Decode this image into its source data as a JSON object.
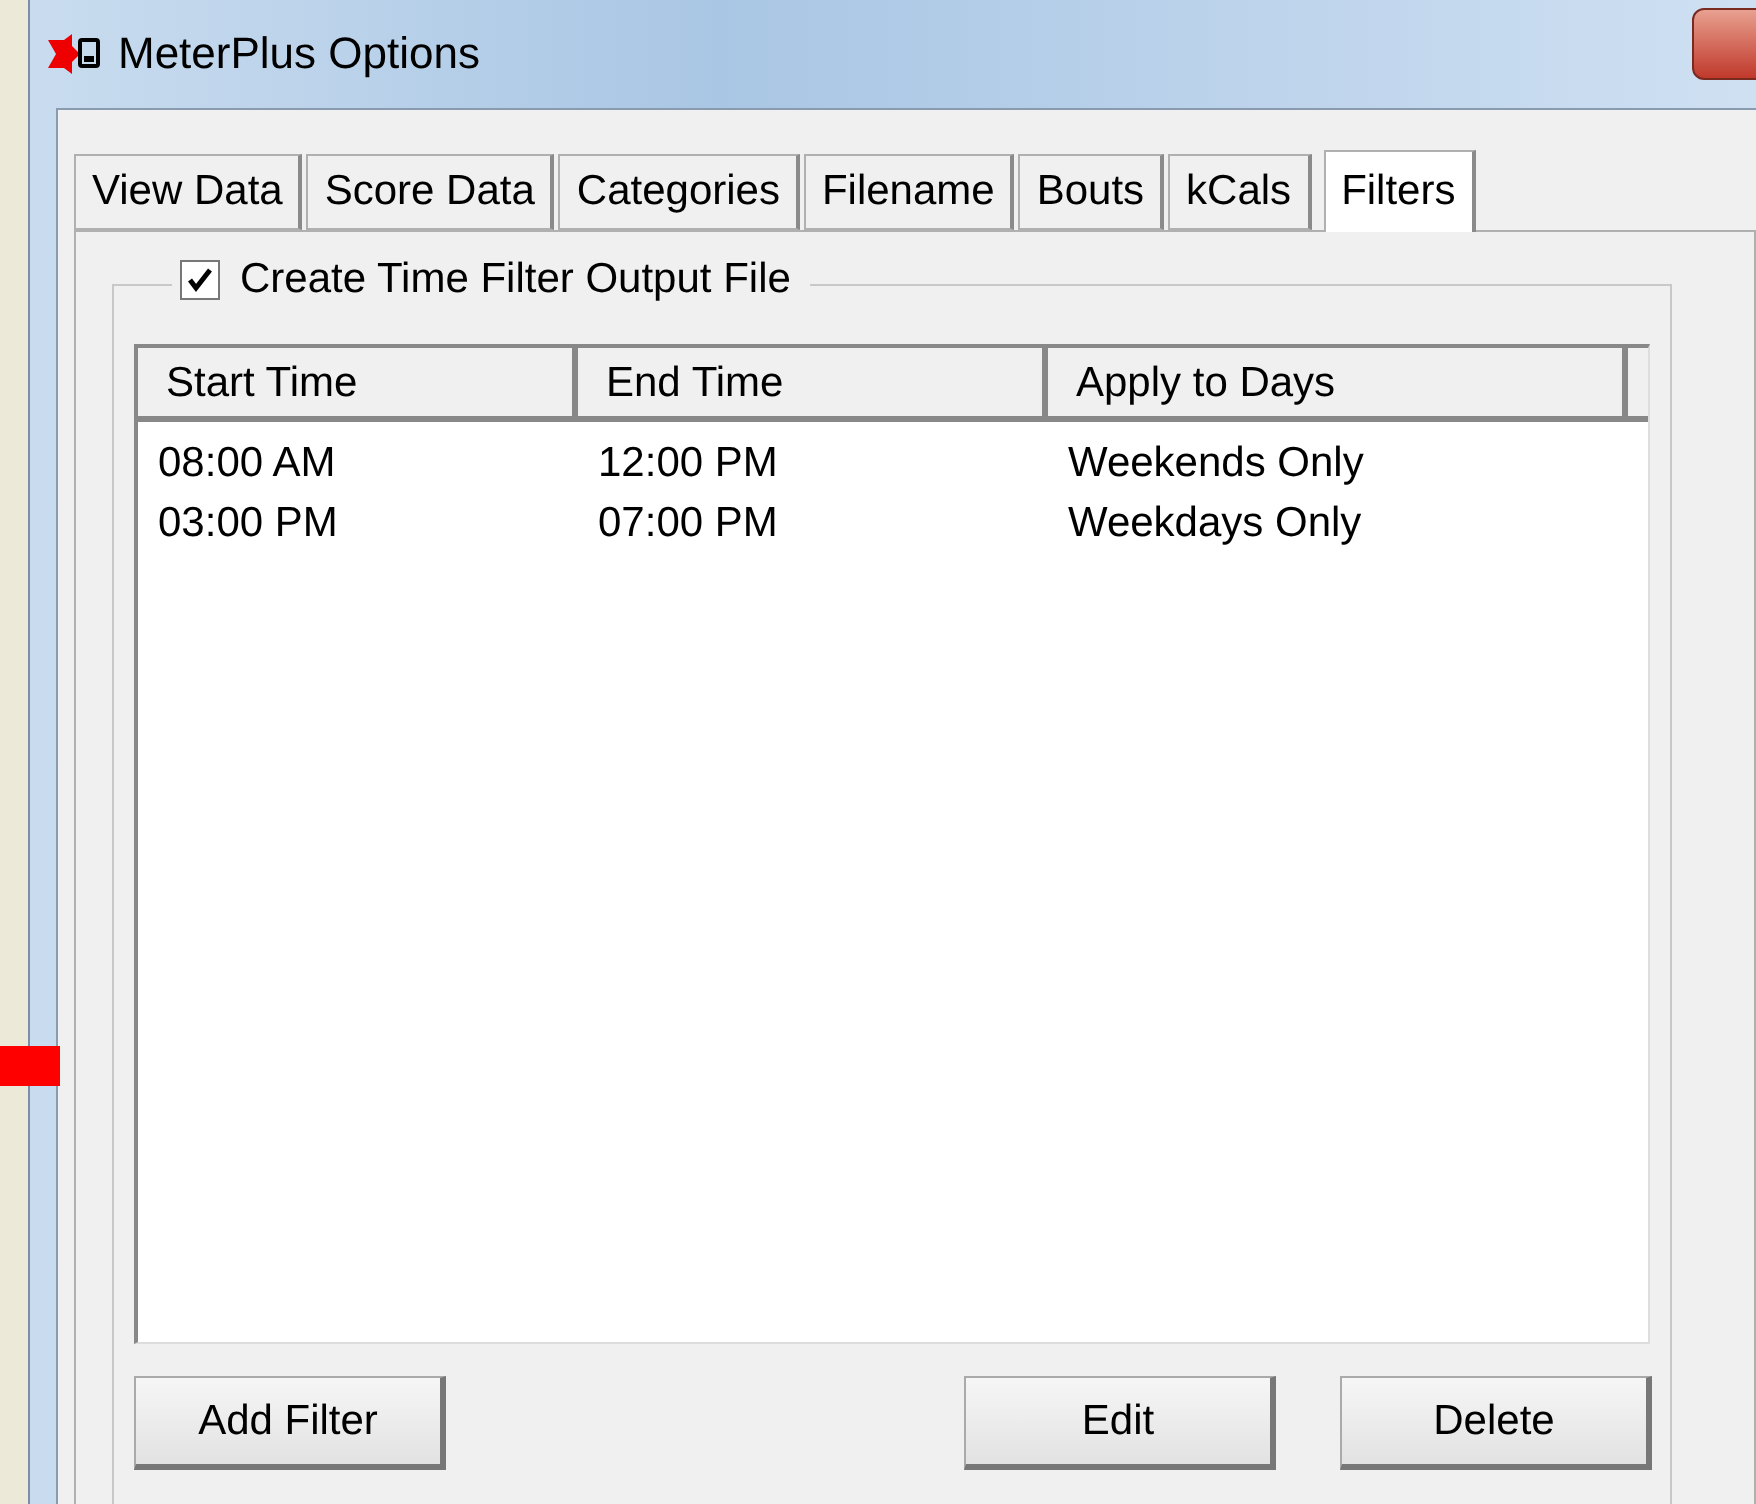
{
  "window": {
    "title": "MeterPlus Options"
  },
  "tabs": [
    {
      "label": "View Data",
      "selected": false
    },
    {
      "label": "Score Data",
      "selected": false
    },
    {
      "label": "Categories",
      "selected": false
    },
    {
      "label": "Filename",
      "selected": false
    },
    {
      "label": "Bouts",
      "selected": false
    },
    {
      "label": "kCals",
      "selected": false
    },
    {
      "label": "Filters",
      "selected": true
    }
  ],
  "filter_group": {
    "label": "Create Time Filter Output File",
    "checked": true
  },
  "table": {
    "columns": [
      "Start Time",
      "End Time",
      "Apply to Days"
    ],
    "rows": [
      [
        "08:00 AM",
        "12:00 PM",
        "Weekends Only"
      ],
      [
        "03:00 PM",
        "07:00 PM",
        "Weekdays Only"
      ]
    ]
  },
  "buttons": [
    "Add Filter",
    "Edit",
    "Delete"
  ]
}
